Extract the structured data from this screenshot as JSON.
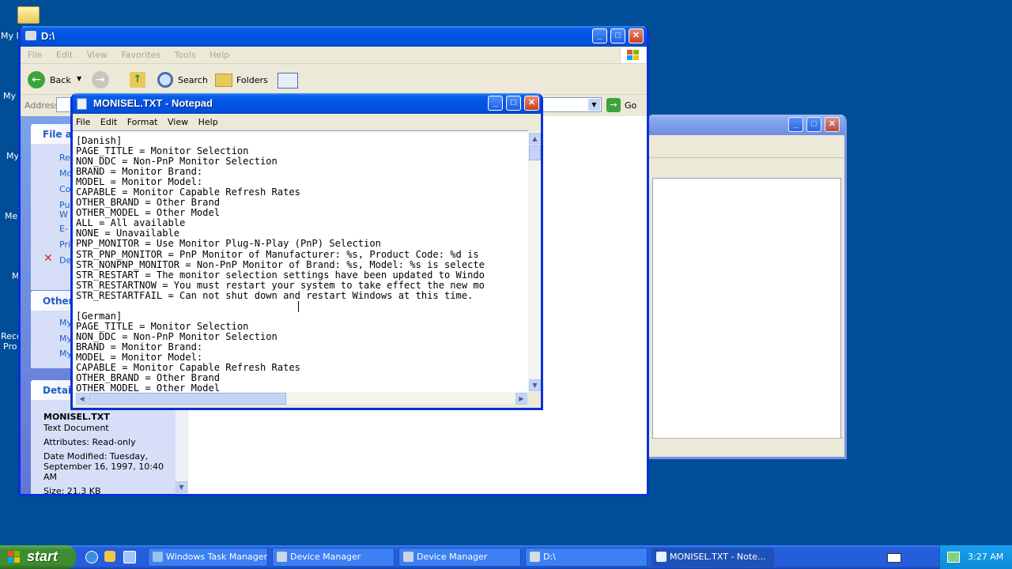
{
  "desktop": {
    "icon_labels": [
      "My D",
      "My",
      "My",
      "Me",
      "M",
      "Recc",
      "Pro"
    ]
  },
  "explorer": {
    "title": "D:\\",
    "menu": [
      "File",
      "Edit",
      "View",
      "Favorites",
      "Tools",
      "Help"
    ],
    "toolbar": {
      "back": "Back",
      "search": "Search",
      "folders": "Folders"
    },
    "address_label": "Address",
    "go_label": "Go",
    "side": {
      "file_tasks_title": "File an",
      "file_tasks": [
        "Re",
        "Mo",
        "Co",
        "Pu",
        "W",
        "E-",
        "Pri",
        "De"
      ],
      "other_title": "Other",
      "other_links": [
        "My",
        "My",
        "My"
      ],
      "details_title": "Details",
      "details_name": "MONISEL.TXT",
      "details_type": "Text Document",
      "details_attr": "Attributes: Read-only",
      "details_date1": "Date Modified: Tuesday,",
      "details_date2": "September 16, 1997, 10:40",
      "details_date3": "AM",
      "details_size": "Size: 21.3 KB"
    }
  },
  "notepad": {
    "title": "MONISEL.TXT - Notepad",
    "menu": [
      "File",
      "Edit",
      "Format",
      "View",
      "Help"
    ],
    "lines": [
      "[Danish]",
      "PAGE_TITLE = Monitor Selection",
      "NON_DDC = Non-PnP Monitor Selection",
      "BRAND = Monitor Brand:",
      "MODEL = Monitor Model:",
      "CAPABLE = Monitor Capable Refresh Rates",
      "OTHER_BRAND = Other Brand",
      "OTHER_MODEL = Other Model",
      "ALL = All available",
      "NONE = Unavailable",
      "PNP_MONITOR = Use Monitor Plug-N-Play (PnP) Selection",
      "STR_PNP_MONITOR = PnP Monitor of Manufacturer: %s, Product Code: %d is",
      "STR_NONPNP_MONITOR = Non-PnP Monitor of Brand: %s, Model: %s is selecte",
      "STR_RESTART = The monitor selection settings have been updated to Windo",
      "STR_RESTARTNOW = You must restart your system to take effect the new mo",
      "STR_RESTARTFAIL = Can not shut down and restart Windows at this time.",
      "",
      "[German]",
      "PAGE_TITLE = Monitor Selection",
      "NON_DDC = Non-PnP Monitor Selection",
      "BRAND = Monitor Brand:",
      "MODEL = Monitor Model:",
      "CAPABLE = Monitor Capable Refresh Rates",
      "OTHER_BRAND = Other Brand",
      "OTHER_MODEL = Other Model"
    ]
  },
  "taskbar": {
    "start": "start",
    "items": [
      {
        "label": "Windows Task Manager",
        "active": false
      },
      {
        "label": "Device Manager",
        "active": false
      },
      {
        "label": "Device Manager",
        "active": false
      },
      {
        "label": "D:\\",
        "active": false
      },
      {
        "label": "MONISEL.TXT - Note...",
        "active": true
      }
    ],
    "clock": "3:27 AM"
  },
  "colors": {
    "desktop": "#004e98",
    "titlebar_active": "#0054e3",
    "taskbar": "#245edb",
    "start_button": "#3c8d2f",
    "link_blue": "#215dc6"
  }
}
